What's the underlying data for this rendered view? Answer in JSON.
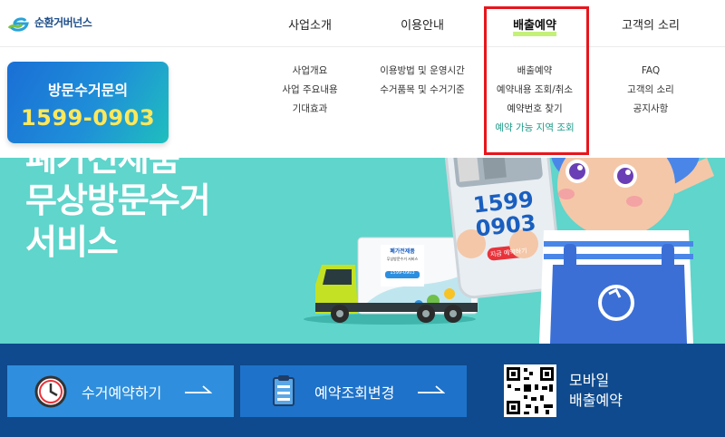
{
  "header": {
    "logo_text": "순환거버넌스",
    "nav": [
      {
        "label": "사업소개",
        "active": false
      },
      {
        "label": "이용안내",
        "active": false
      },
      {
        "label": "배출예약",
        "active": true
      },
      {
        "label": "고객의 소리",
        "active": false
      }
    ]
  },
  "mega_menu": {
    "columns": [
      {
        "items": [
          "사업개요",
          "사업 주요내용",
          "기대효과"
        ]
      },
      {
        "items": [
          "이용방법 및 운영시간",
          "수거품목 및 수거기준"
        ]
      },
      {
        "items": [
          "배출예약",
          "예약내용 조회/취소",
          "예약번호 찾기",
          "예약 가능 지역 조회"
        ],
        "highlight_index": 3
      },
      {
        "items": [
          "FAQ",
          "고객의 소리",
          "공지사항"
        ]
      }
    ]
  },
  "call_card": {
    "label": "방문수거문의",
    "number": "1599-0903"
  },
  "hero": {
    "title_lines": [
      "폐가전제품",
      "무상방문수거",
      "서비스"
    ],
    "phone_number_top": "1599",
    "phone_number_bottom": "0903",
    "phone_button": "지금 예약하기",
    "truck_text_line1": "폐가전제품",
    "truck_text_line2": "무상방문수거 서비스",
    "truck_number": "1599-0903"
  },
  "bottom": {
    "reserve_label": "수거예약하기",
    "change_label": "예약조회변경",
    "mobile_line1": "모바일",
    "mobile_line2": "배출예약"
  },
  "colors": {
    "hero_bg": "#5fd5cb",
    "band_bg": "#0e4a8d",
    "highlight_box": "#e8161c",
    "menu_highlight": "#1b9a88",
    "call_number": "#ffe85a"
  }
}
